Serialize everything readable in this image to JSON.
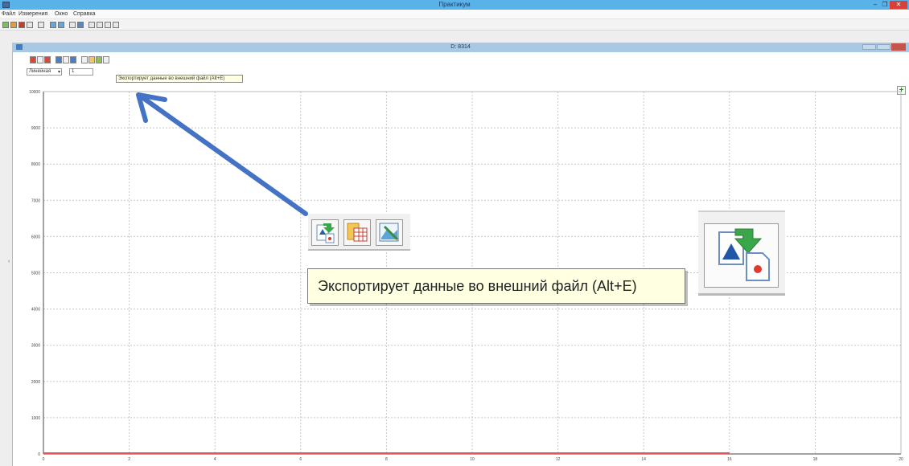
{
  "window": {
    "title": "Практикум",
    "minimize_glyph": "–",
    "maximize_glyph": "❐",
    "close_glyph": "✕"
  },
  "menu": [
    "Файл",
    "Измерения",
    "Окно",
    "Справка"
  ],
  "document": {
    "title": "D: 8314"
  },
  "plot_controls": {
    "scale_mode": "Линейная",
    "value": "1"
  },
  "tooltip": {
    "small_text": "Экспортирует данные во внешний файл (Alt+E)",
    "large_text": "Экспортирует данные во внешний файл (Alt+E)"
  },
  "plus_glyph": "+",
  "icons": {
    "zoom_toolbar": [
      "export-file-icon",
      "table-icon",
      "image-edit-icon"
    ],
    "big_icon": "export-file-icon",
    "annotation": "blue-arrow"
  },
  "colors": {
    "titlebar": "#59b3e9",
    "arrow": "#4472c4",
    "series": "#e15759",
    "tooltip_bg": "#ffffe1"
  },
  "chart_data": {
    "type": "line",
    "title": "",
    "xlabel": "",
    "ylabel": "",
    "x_ticks": [
      "0",
      "2",
      "4",
      "6",
      "8",
      "10",
      "12",
      "14",
      "16",
      "18",
      "20"
    ],
    "y_ticks": [
      "0",
      "1000",
      "2000",
      "3000",
      "4000",
      "5000",
      "6000",
      "7000",
      "8000",
      "9000",
      "10000"
    ],
    "xlim": [
      0,
      20
    ],
    "ylim": [
      0,
      10000
    ],
    "grid": true,
    "series": [
      {
        "x": [
          0,
          16
        ],
        "y": [
          0,
          0
        ],
        "color": "#e15759"
      }
    ]
  }
}
